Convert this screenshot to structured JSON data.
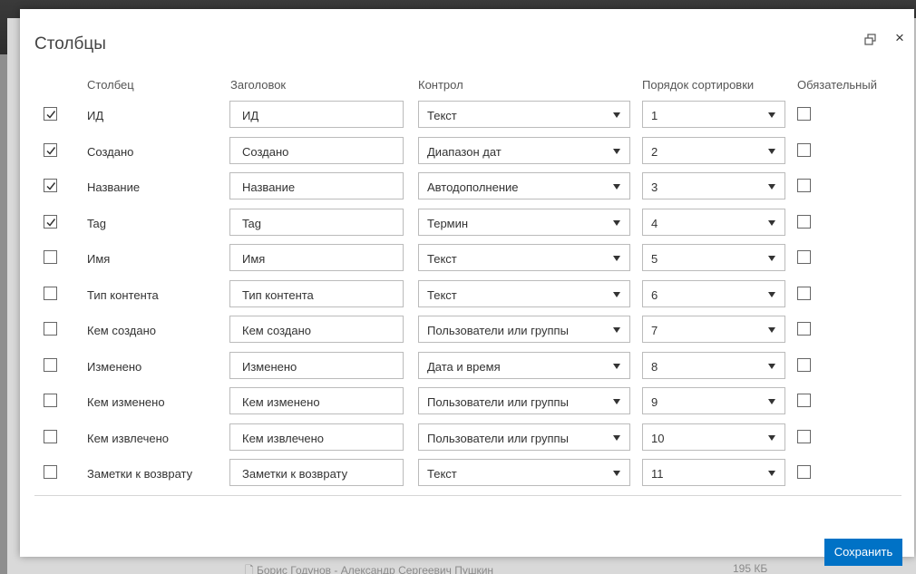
{
  "dialog": {
    "title": "Столбцы",
    "maximize_icon": "restore-window-icon",
    "close_label": "×",
    "save_label": "Сохранить",
    "accent_color": "#0072c6"
  },
  "headers": {
    "column": "Столбец",
    "title": "Заголовок",
    "control": "Контрол",
    "sort_order": "Порядок сортировки",
    "required": "Обязательный"
  },
  "rows": [
    {
      "checked": true,
      "name": "ИД",
      "title": "ИД",
      "control": "Текст",
      "order": "1",
      "required": false
    },
    {
      "checked": true,
      "name": "Создано",
      "title": "Создано",
      "control": "Диапазон дат",
      "order": "2",
      "required": false
    },
    {
      "checked": true,
      "name": "Название",
      "title": "Название",
      "control": "Автодополнение",
      "order": "3",
      "required": false
    },
    {
      "checked": true,
      "name": "Tag",
      "title": "Tag",
      "control": "Термин",
      "order": "4",
      "required": false
    },
    {
      "checked": false,
      "name": "Имя",
      "title": "Имя",
      "control": "Текст",
      "order": "5",
      "required": false
    },
    {
      "checked": false,
      "name": "Тип контента",
      "title": "Тип контента",
      "control": "Текст",
      "order": "6",
      "required": false
    },
    {
      "checked": false,
      "name": "Кем создано",
      "title": "Кем создано",
      "control": "Пользователи или группы",
      "order": "7",
      "required": false
    },
    {
      "checked": false,
      "name": "Изменено",
      "title": "Изменено",
      "control": "Дата и время",
      "order": "8",
      "required": false
    },
    {
      "checked": false,
      "name": "Кем изменено",
      "title": "Кем изменено",
      "control": "Пользователи или группы",
      "order": "9",
      "required": false
    },
    {
      "checked": false,
      "name": "Кем извлечено",
      "title": "Кем извлечено",
      "control": "Пользователи или группы",
      "order": "10",
      "required": false
    },
    {
      "checked": false,
      "name": "Заметки к возврату",
      "title": "Заметки к возврату",
      "control": "Текст",
      "order": "11",
      "required": false
    }
  ],
  "background": {
    "row_text": "Борис Годунов - Александр Сергеевич Пушкин",
    "row_size": "195 КБ"
  }
}
